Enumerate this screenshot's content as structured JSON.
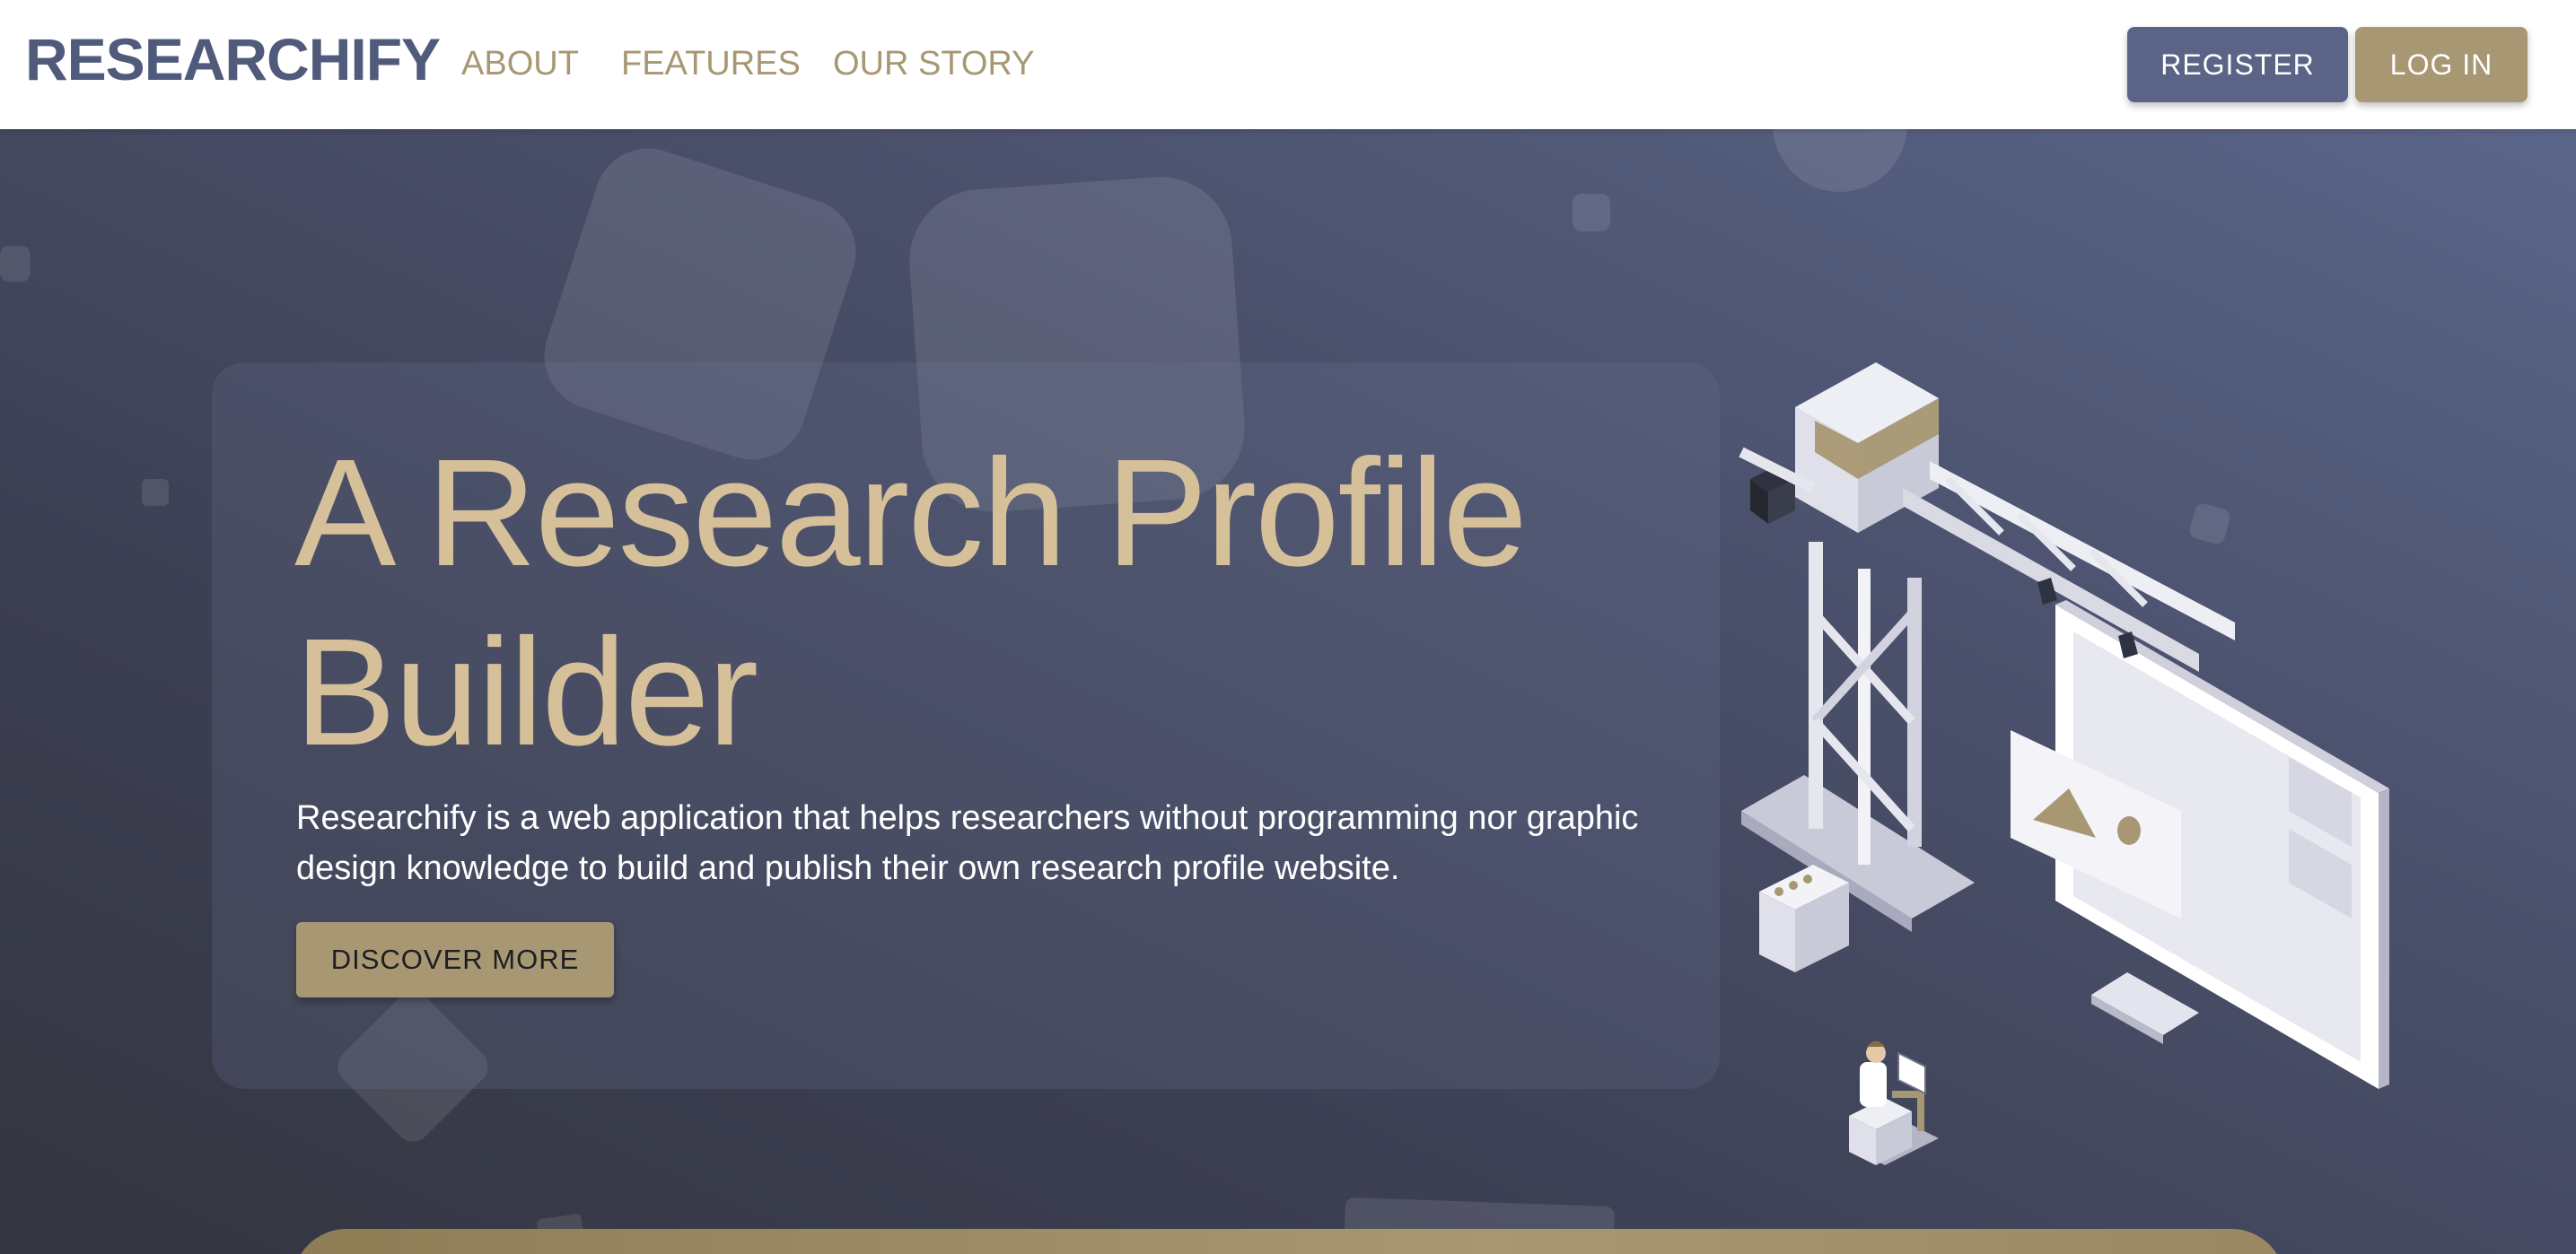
{
  "navbar": {
    "logo": "RESEARCHIFY",
    "links": [
      "ABOUT",
      "FEATURES",
      "OUR STORY"
    ],
    "register_label": "REGISTER",
    "login_label": "LOG IN"
  },
  "hero": {
    "title": "A Research Profile Builder",
    "description": "Researchify is a web application that helps researchers without programming nor graphic design knowledge to build and publish their own research profile website.",
    "cta_label": "DISCOVER MORE"
  },
  "colors": {
    "brand": "#505b7c",
    "accent_gold": "#a89773",
    "register_bg": "#5b6486",
    "hero_title": "#d6c09a"
  }
}
